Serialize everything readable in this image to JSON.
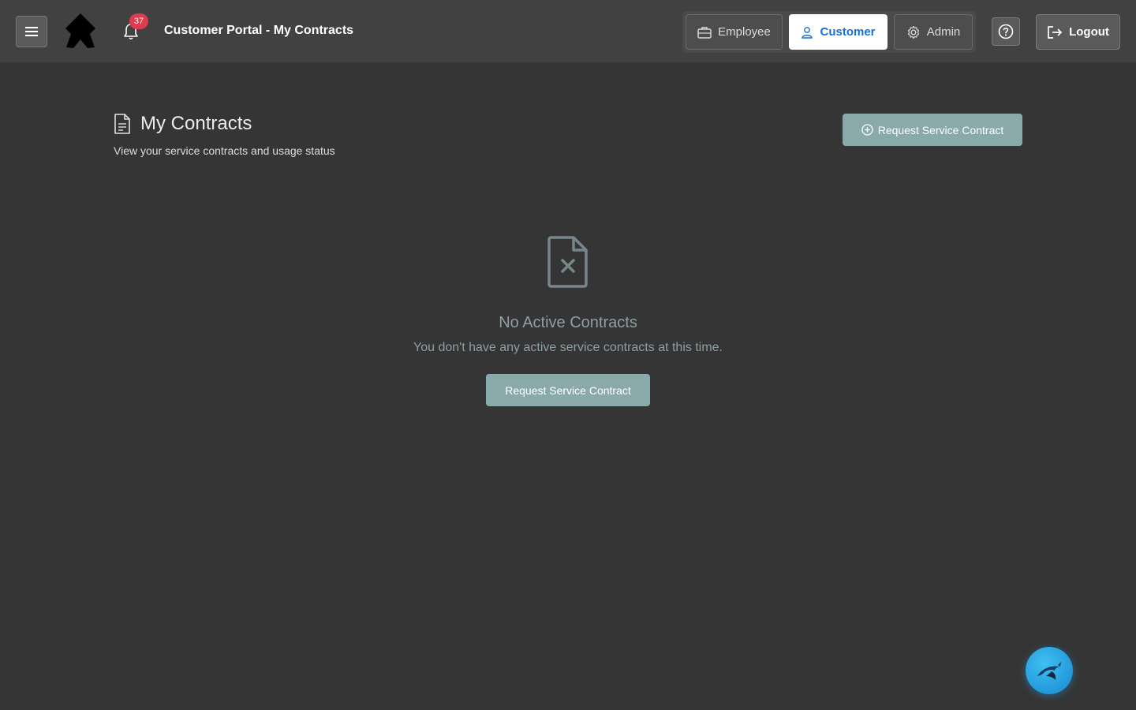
{
  "header": {
    "title": "Customer Portal - My Contracts",
    "notification_count": "37",
    "roles": [
      {
        "label": "Employee",
        "icon": "briefcase-icon",
        "active": false
      },
      {
        "label": "Customer",
        "icon": "user-icon",
        "active": true
      },
      {
        "label": "Admin",
        "icon": "gear-icon",
        "active": false
      }
    ],
    "logout_label": "Logout"
  },
  "page": {
    "title": "My Contracts",
    "subtitle": "View your service contracts and usage status",
    "request_button_label": "Request Service Contract"
  },
  "empty_state": {
    "icon": "file-x-icon",
    "title": "No Active Contracts",
    "message": "You don't have any active service contracts at this time.",
    "button_label": "Request Service Contract"
  },
  "colors": {
    "background": "#353535",
    "topbar": "#414141",
    "accent_button": "#8aa9ab",
    "active_role_text": "#1670d6",
    "badge": "#e03a4e",
    "muted_text": "#8f9ea3",
    "fab": "#1e9ee0"
  }
}
